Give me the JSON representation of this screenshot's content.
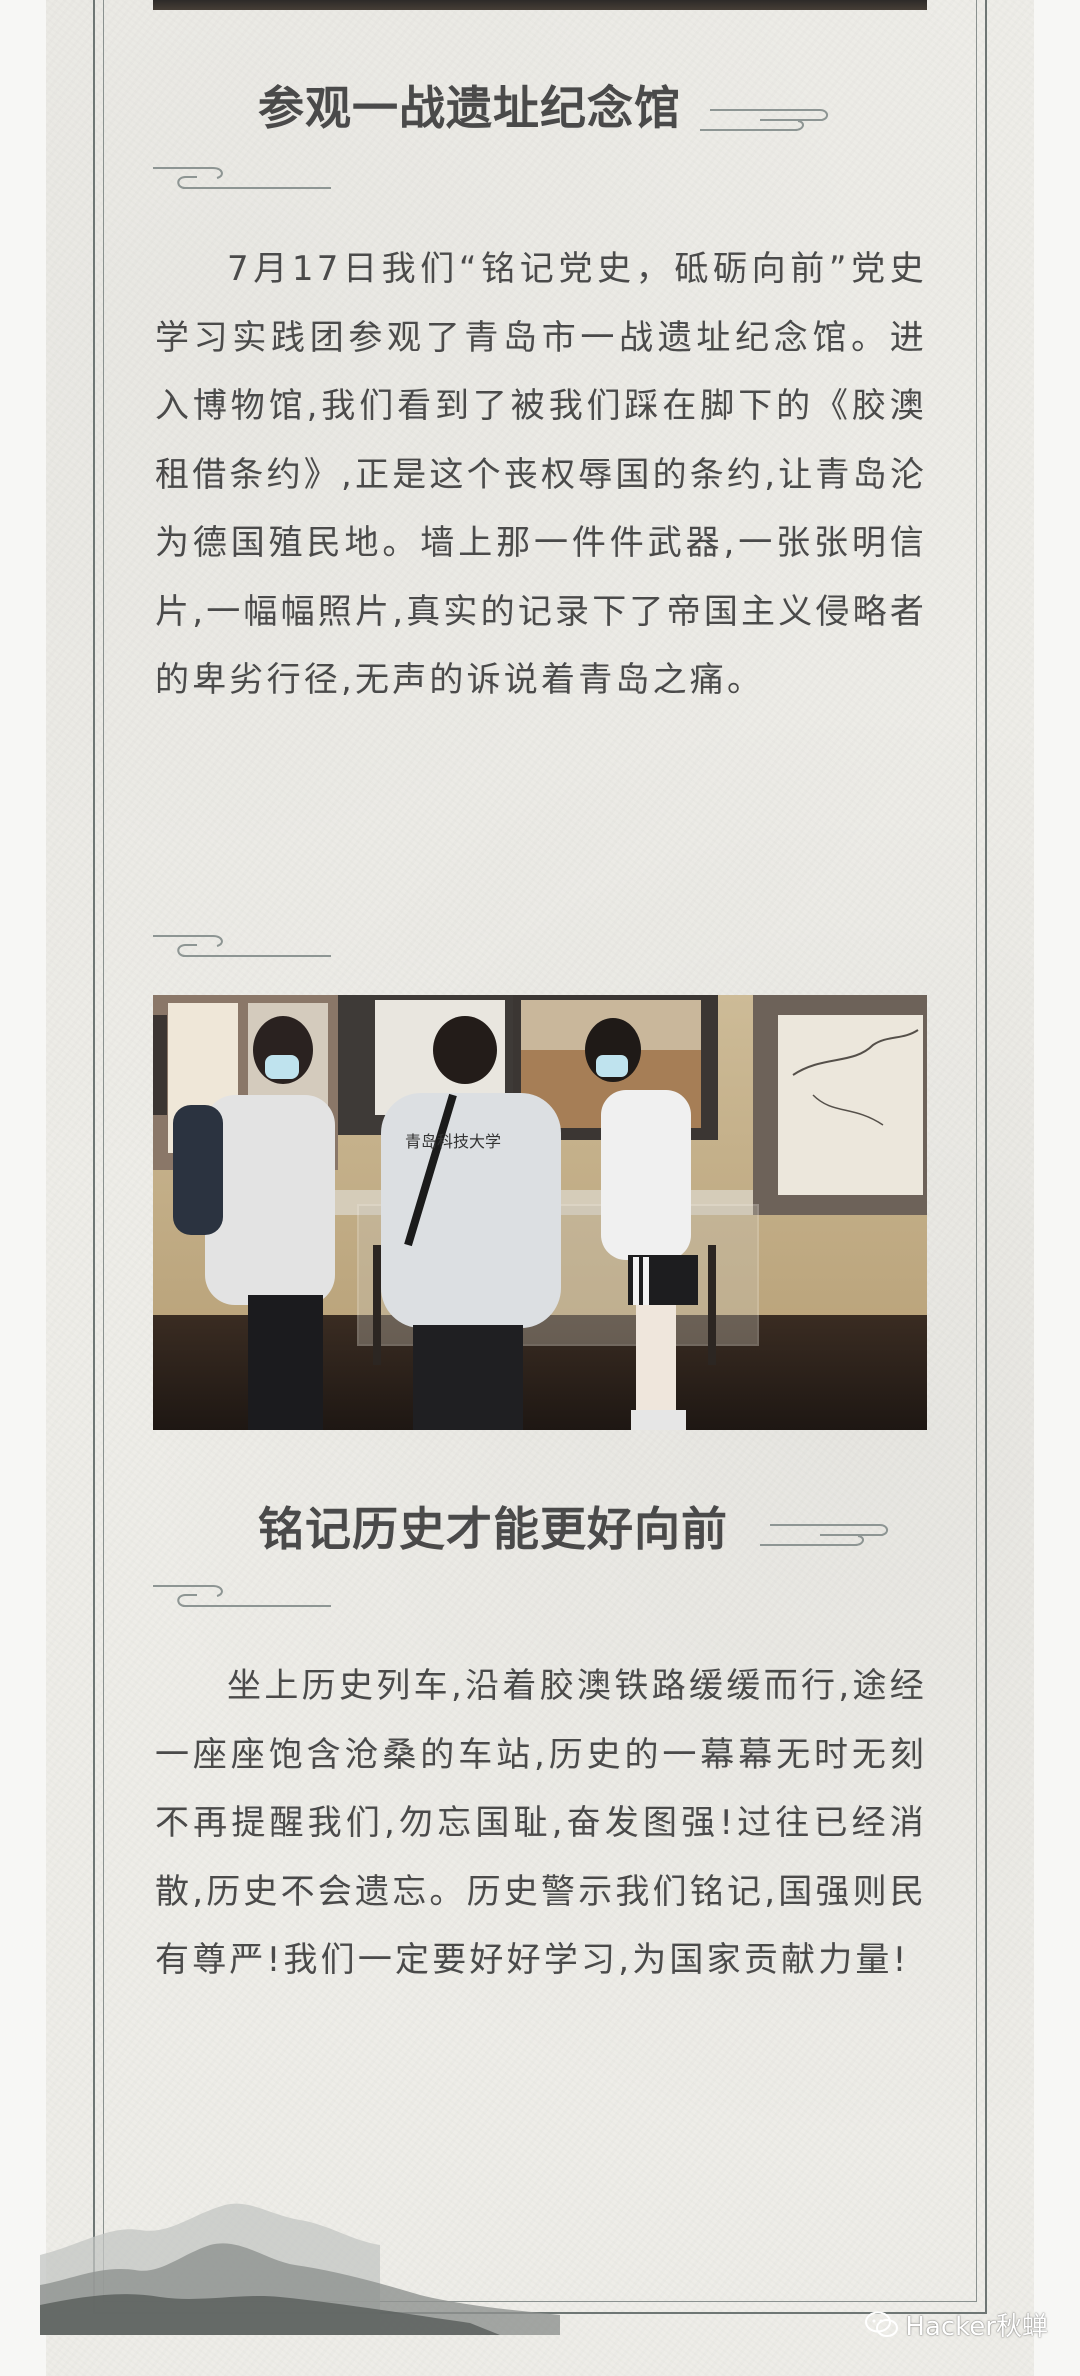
{
  "section1": {
    "title": "参观一战遗址纪念馆",
    "body": "7月17日我们“铭记党史，砥砺向前”党史学习实践团参观了青岛市一战遗址纪念馆。进入博物馆,我们看到了被我们踩在脚下的《胶澳租借条约》,正是这个丧权辱国的条约,让青岛沦为德国殖民地。墙上那一件件武器,一张张明信片,一幅幅照片,真实的记录下了帝国主义侵略者的卑劣行径,无声的诉说着青岛之痛。"
  },
  "photo": {
    "shirt_print": "青岛科技大学"
  },
  "section2": {
    "title": "铭记历史才能更好向前",
    "body": "坐上历史列车,沿着胶澳铁路缓缓而行,途经一座座饱含沧桑的车站,历史的一幕幕无时无刻不再提醒我们,勿忘国耻,奋发图强!过往已经消散,历史不会遗忘。历史警示我们铭记,国强则民有尊严!我们一定要好好学习,为国家贡献力量!"
  },
  "watermark": {
    "text": "Hacker秋蝉",
    "icon": "wechat-icon"
  },
  "colors": {
    "background": "#eeede8",
    "frame": "#6e7674",
    "text": "#4a4a4a"
  }
}
